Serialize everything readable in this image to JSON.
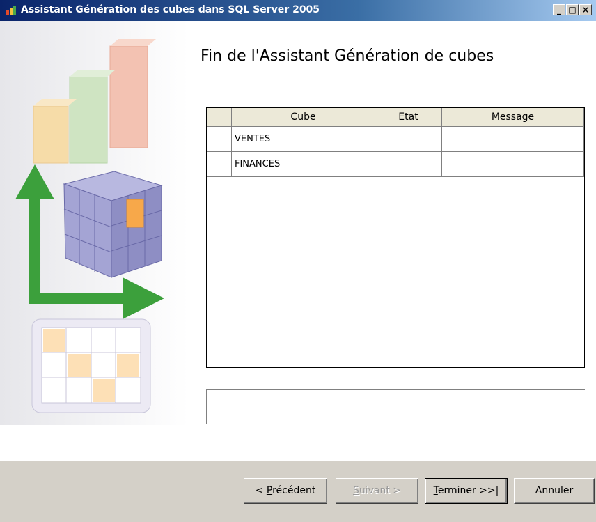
{
  "window": {
    "title": "Assistant Génération des cubes dans SQL Server 2005",
    "controls": {
      "minimize": "_",
      "maximize": "□",
      "close": "×"
    }
  },
  "page": {
    "heading": "Fin de l'Assistant Génération de cubes"
  },
  "table": {
    "columns": [
      "",
      "Cube",
      "Etat",
      "Message"
    ],
    "rows": [
      {
        "selector": "",
        "cube": "VENTES",
        "etat": "",
        "message": ""
      },
      {
        "selector": "",
        "cube": "FINANCES",
        "etat": "",
        "message": ""
      }
    ]
  },
  "message_area": {
    "text": ""
  },
  "buttons": {
    "previous": {
      "prefix": "< ",
      "mnemonic": "P",
      "rest": "récédent"
    },
    "next": {
      "mnemonic": "S",
      "rest": "uivant >"
    },
    "finish": {
      "mnemonic": "T",
      "rest": "erminer >>|"
    },
    "cancel": {
      "label": "Annuler"
    }
  },
  "colors": {
    "titlebar_start": "#0a246a",
    "dialog_face": "#d4d0c8",
    "arrow_green": "#3ca03c",
    "cube_purple": "#9b9bd1",
    "highlight_orange": "#f7a84a"
  },
  "icons": [
    "wizard-app-icon",
    "bar-chart-illustration",
    "cube-illustration",
    "axis-arrows-illustration",
    "grid-table-illustration"
  ]
}
